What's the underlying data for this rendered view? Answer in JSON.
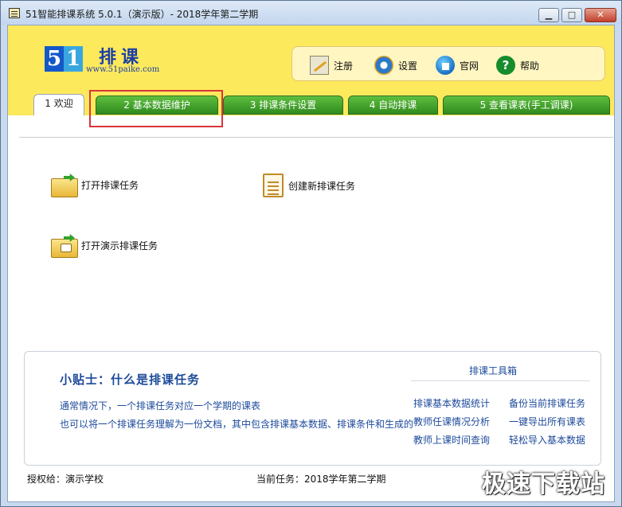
{
  "window": {
    "title": "51智能排课系统 5.0.1（演示版）- 2018学年第二学期",
    "min_glyph": "▁",
    "max_glyph": "□",
    "close_glyph": "✕"
  },
  "logo": {
    "digit1": "5",
    "digit2": "1",
    "name": "排课",
    "url": "www.51paike.com"
  },
  "toolbar": {
    "register": "注册",
    "settings": "设置",
    "website": "官网",
    "help": "帮助",
    "help_glyph": "?"
  },
  "tabs": [
    {
      "label": "1 欢迎"
    },
    {
      "label": "2 基本数据维护"
    },
    {
      "label": "3 排课条件设置"
    },
    {
      "label": "4 自动排课"
    },
    {
      "label": "5 查看课表(手工调课)"
    }
  ],
  "actions": {
    "open_task": "打开排课任务",
    "new_task": "创建新排课任务",
    "open_demo": "打开演示排课任务"
  },
  "tips": {
    "title": "小贴士：什么是排课任务",
    "line1": "通常情况下，一个排课任务对应一个学期的课表",
    "line2": "也可以将一个排课任务理解为一份文档，其中包含排课基本数据、排课条件和生成的"
  },
  "toolbox": {
    "title": "排课工具箱",
    "links": [
      "排课基本数据统计",
      "备份当前排课任务",
      "教师任课情况分析",
      "一键导出所有课表",
      "教师上课时间查询",
      "轻松导入基本数据"
    ]
  },
  "status": {
    "licensed_to": "授权给：演示学校",
    "current_task": "当前任务：2018学年第二学期"
  },
  "watermark": "极速下载站",
  "colors": {
    "header_bg": "#fde95c",
    "tab_green": "#3f9e25",
    "highlight_red": "#d9353b",
    "link_blue": "#1d4a9b"
  }
}
